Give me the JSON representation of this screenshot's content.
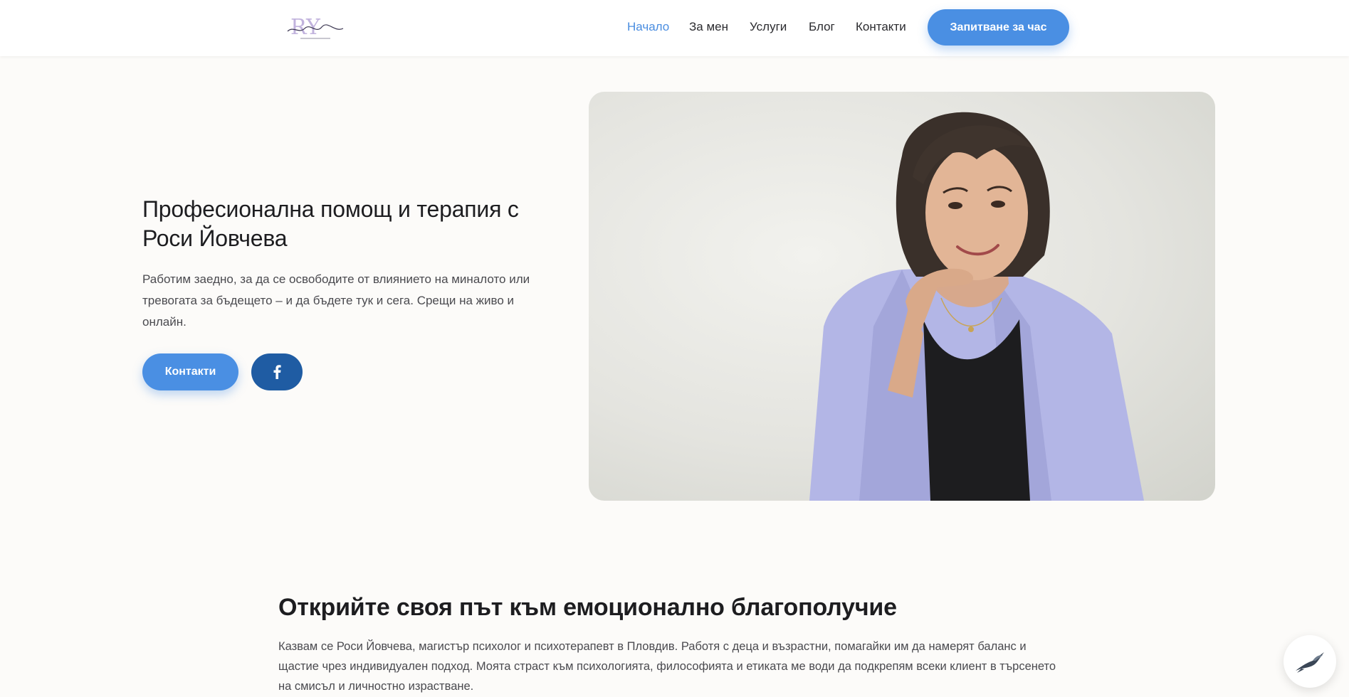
{
  "header": {
    "logo_icon": "ry-signature-logo",
    "nav": [
      {
        "label": "Начало",
        "active": true
      },
      {
        "label": "За мен",
        "active": false
      },
      {
        "label": "Услуги",
        "active": false
      },
      {
        "label": "Блог",
        "active": false
      },
      {
        "label": "Контакти",
        "active": false
      }
    ],
    "cta_label": "Запитване за час"
  },
  "hero": {
    "title": "Професионална помощ и терапия с Роси Йовчева",
    "text": "Работим заедно, за да се освободите от влиянието на миналото или тревогата за бъдещето – и да бъдете тук и сега. Срещи на живо и онлайн.",
    "contact_button": "Контакти",
    "facebook_icon": "facebook-icon",
    "image": "portrait-photo"
  },
  "about": {
    "title": "Открийте своя път към емоционално благополучие",
    "text": "Казвам се Роси Йовчева, магистър психолог и психотерапевт в Пловдив. Работя с деца и възрастни, помагайки им да намерят баланс и щастие чрез индивидуален подход. Моята страст към психологията, философията и етиката ме води да подкрепям всеки клиент в търсенето на смисъл и личностно израстване."
  },
  "chat_widget": {
    "icon": "swallow-bird-icon"
  },
  "colors": {
    "accent": "#4a8fe3",
    "facebook": "#1f5ca3",
    "background": "#fcfbf9"
  }
}
